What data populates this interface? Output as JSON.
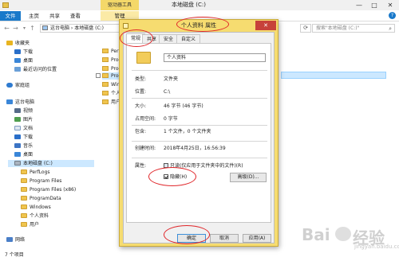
{
  "explorer": {
    "title": "本地磁盘 (C:)",
    "context_tab": "驱动器工具",
    "window_controls": [
      "—",
      "□",
      "✕"
    ],
    "ribbon_tabs": [
      "文件",
      "主页",
      "共享",
      "查看",
      "管理"
    ],
    "address": "这台电脑 › 本地磁盘 (C:)",
    "search_placeholder": "搜索\"本地磁盘 (C:)\"",
    "status": "7 个项目",
    "icons": [
      "back-arrow-icon",
      "forward-arrow-icon",
      "up-arrow-icon",
      "refresh-icon",
      "search-icon"
    ]
  },
  "nav": {
    "favorites": "收藏夹",
    "fav_items": [
      "下载",
      "桌面",
      "最近访问的位置"
    ],
    "homegroup": "家庭组",
    "thispc": "这台电脑",
    "pc_items": [
      "视频",
      "图片",
      "文档",
      "下载",
      "音乐",
      "桌面"
    ],
    "drive": "本地磁盘 (C:)",
    "drive_children": [
      "PerfLogs",
      "Program Files",
      "Program Files (x86)",
      "ProgramData",
      "Windows",
      "个人资料",
      "用户"
    ],
    "network": "网络"
  },
  "content": {
    "rows": [
      "Perf",
      "Prog",
      "Prog",
      "Prog",
      "Win",
      "个人",
      "用户"
    ]
  },
  "dialog": {
    "title": "个人资料 属性",
    "close": "✕",
    "tabs": [
      "常规",
      "共享",
      "安全",
      "自定义"
    ],
    "name": "个人资料",
    "props": [
      {
        "label": "类型:",
        "value": "文件夹"
      },
      {
        "label": "位置:",
        "value": "C:\\"
      },
      {
        "label": "大小:",
        "value": "46 字节 (46 字节)"
      },
      {
        "label": "占用空间:",
        "value": "0 字节"
      },
      {
        "label": "包含:",
        "value": "1 个文件，0 个文件夹"
      },
      {
        "label": "创建时间:",
        "value": "2018年4月25日，16:56:39"
      }
    ],
    "attr_label": "属性:",
    "readonly_label": "只读(仅应用于文件夹中的文件)(R)",
    "hidden_label": "隐藏(H)",
    "hidden_checked": true,
    "advanced": "高级(D)...",
    "ok": "确定",
    "cancel": "取消",
    "apply": "应用(A)"
  },
  "watermark": {
    "text_left": "Bai",
    "text_right": "经验",
    "sub": "jingyan.baidu.com"
  }
}
